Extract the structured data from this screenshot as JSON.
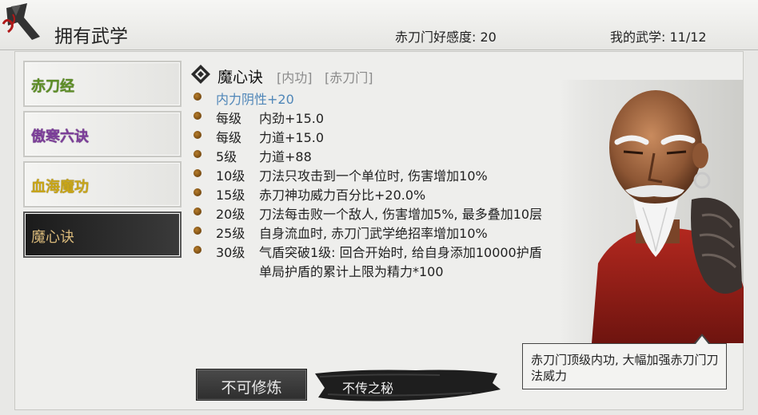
{
  "header": {
    "title": "拥有武学",
    "favor_text": "赤刀门好感度: 20",
    "martial_count_text": "我的武学: 11/12"
  },
  "skills": [
    {
      "label": "赤刀经",
      "color": "#5d8e25"
    },
    {
      "label": "傲寒六诀",
      "color": "#7d3e9a"
    },
    {
      "label": "血海魔功",
      "color": "#c9a618"
    },
    {
      "label": "魔心诀",
      "color": "#d9b97a",
      "selected": true
    }
  ],
  "detail": {
    "name": "魔心诀",
    "tags": [
      "[内功]",
      "[赤刀门]"
    ],
    "bonus": "内力阴性+20",
    "effects": [
      {
        "level": "每级",
        "text": "内劲+15.0"
      },
      {
        "level": "每级",
        "text": "力道+15.0"
      },
      {
        "level": "5级",
        "text": "力道+88"
      },
      {
        "level": "10级",
        "text": "刀法只攻击到一个单位时, 伤害增加10%"
      },
      {
        "level": "15级",
        "text": "赤刀神功威力百分比+20.0%"
      },
      {
        "level": "20级",
        "text": "刀法每击败一个敌人, 伤害增加5%, 最多叠加10层"
      },
      {
        "level": "25级",
        "text": "自身流血时, 赤刀门武学绝招率增加10%"
      },
      {
        "level": "30级",
        "text": "气盾突破1级: 回合开始时, 给自身添加10000护盾",
        "text2": "单局护盾的累计上限为精力*100"
      }
    ]
  },
  "description": "赤刀门顶级内功, 大幅加强赤刀门刀法威力",
  "buttons": {
    "cultivate": "不可修炼",
    "secret": "不传之秘"
  }
}
